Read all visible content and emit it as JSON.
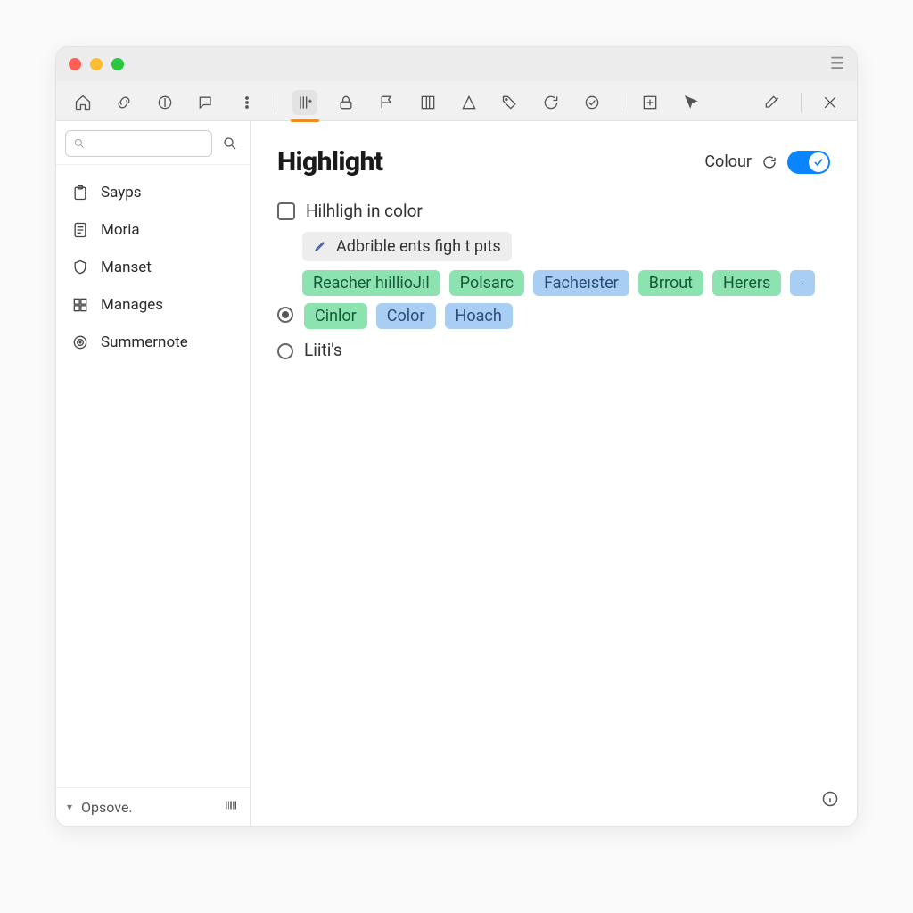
{
  "sidebar": {
    "search_placeholder": "",
    "items": [
      {
        "label": "Sayps"
      },
      {
        "label": "Moria"
      },
      {
        "label": "Manset"
      },
      {
        "label": "Manages"
      },
      {
        "label": "Summernote"
      }
    ],
    "footer_label": "Opsove."
  },
  "main": {
    "heading": "Highlight",
    "colour_label": "Colour",
    "toggle_on": true,
    "checkbox_label": "Hilhligh in color",
    "note_text": "Adbrible ents figh t pıts",
    "tag_row_1": [
      {
        "text": "Reacher hıillioJıl",
        "color": "green"
      },
      {
        "text": "Polsarc",
        "color": "green"
      },
      {
        "text": "Facheıster",
        "color": "blue"
      },
      {
        "text": "Brrout",
        "color": "green"
      },
      {
        "text": "Herers",
        "color": "green"
      }
    ],
    "tag_row_2": [
      {
        "text": "Cinlor",
        "color": "green"
      },
      {
        "text": "Color",
        "color": "blue"
      },
      {
        "text": "Hoach",
        "color": "blue"
      }
    ],
    "radio2_label": "Liiti's"
  },
  "colors": {
    "green": "#8ce3b0",
    "blue": "#a9cef4",
    "accent_orange": "#f08a24",
    "toggle_blue": "#0a84ff"
  }
}
